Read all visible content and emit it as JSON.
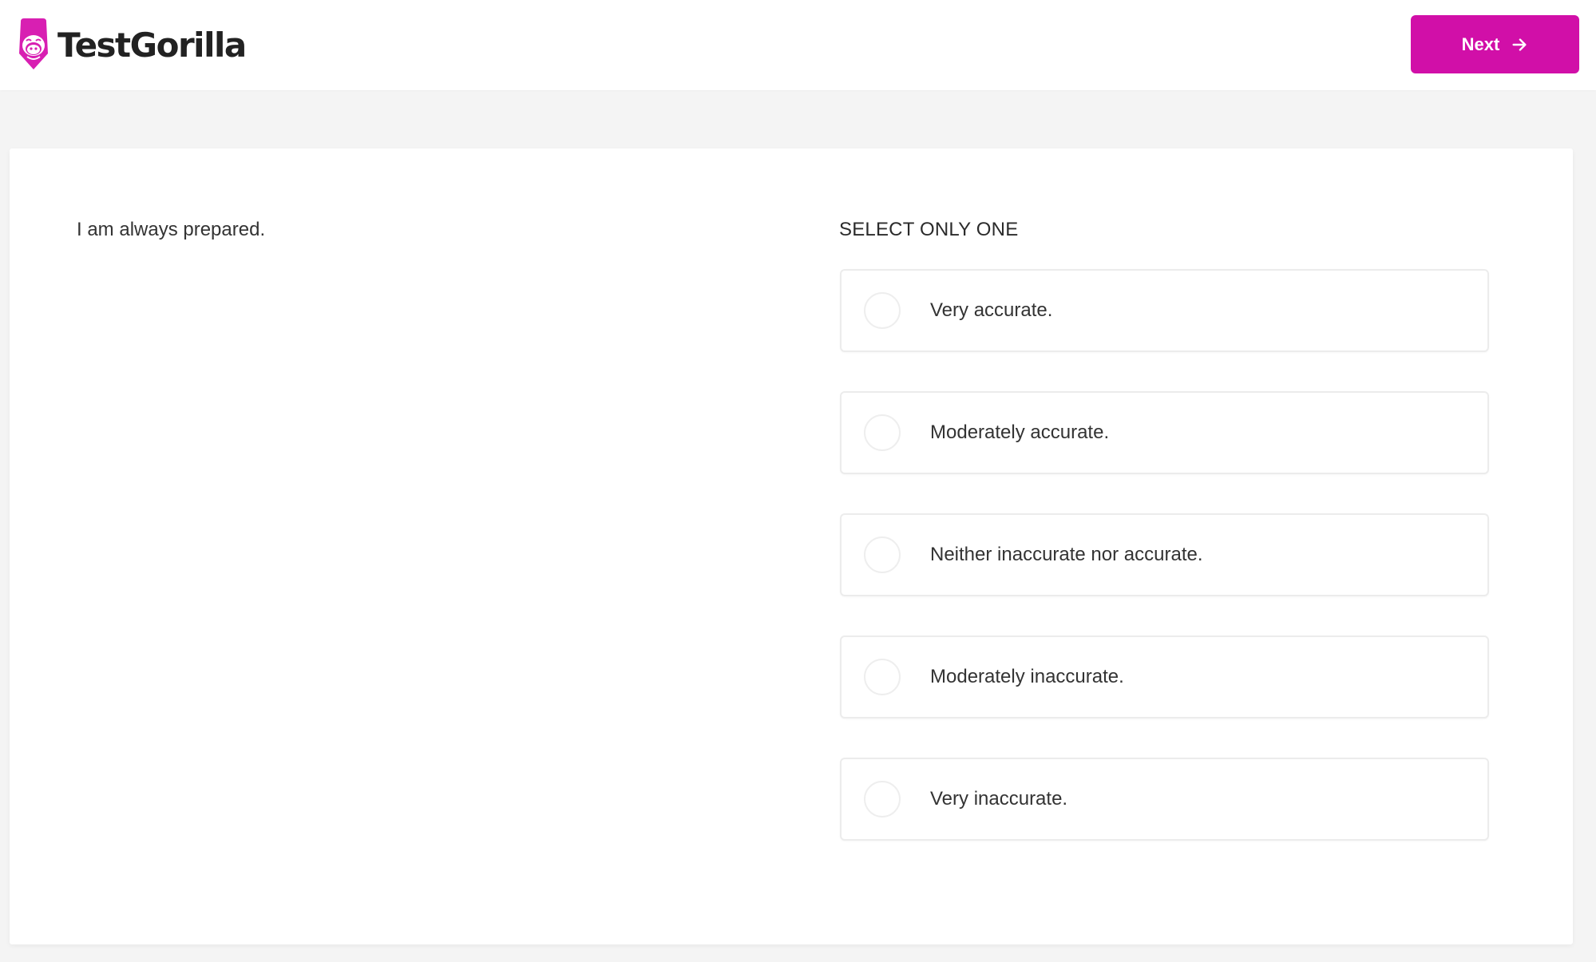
{
  "brand": {
    "name": "TestGorilla",
    "accent_color": "#d10fa8"
  },
  "header": {
    "logo_icon": "gorilla-icon",
    "next_button": {
      "label": "Next",
      "icon": "arrow-right-icon"
    }
  },
  "question": {
    "text": "I am always prepared.",
    "instruction": "SELECT ONLY ONE",
    "options": [
      {
        "label": "Very accurate.",
        "selected": false
      },
      {
        "label": "Moderately accurate.",
        "selected": false
      },
      {
        "label": "Neither inaccurate nor accurate.",
        "selected": false
      },
      {
        "label": "Moderately inaccurate.",
        "selected": false
      },
      {
        "label": "Very inaccurate.",
        "selected": false
      }
    ]
  }
}
